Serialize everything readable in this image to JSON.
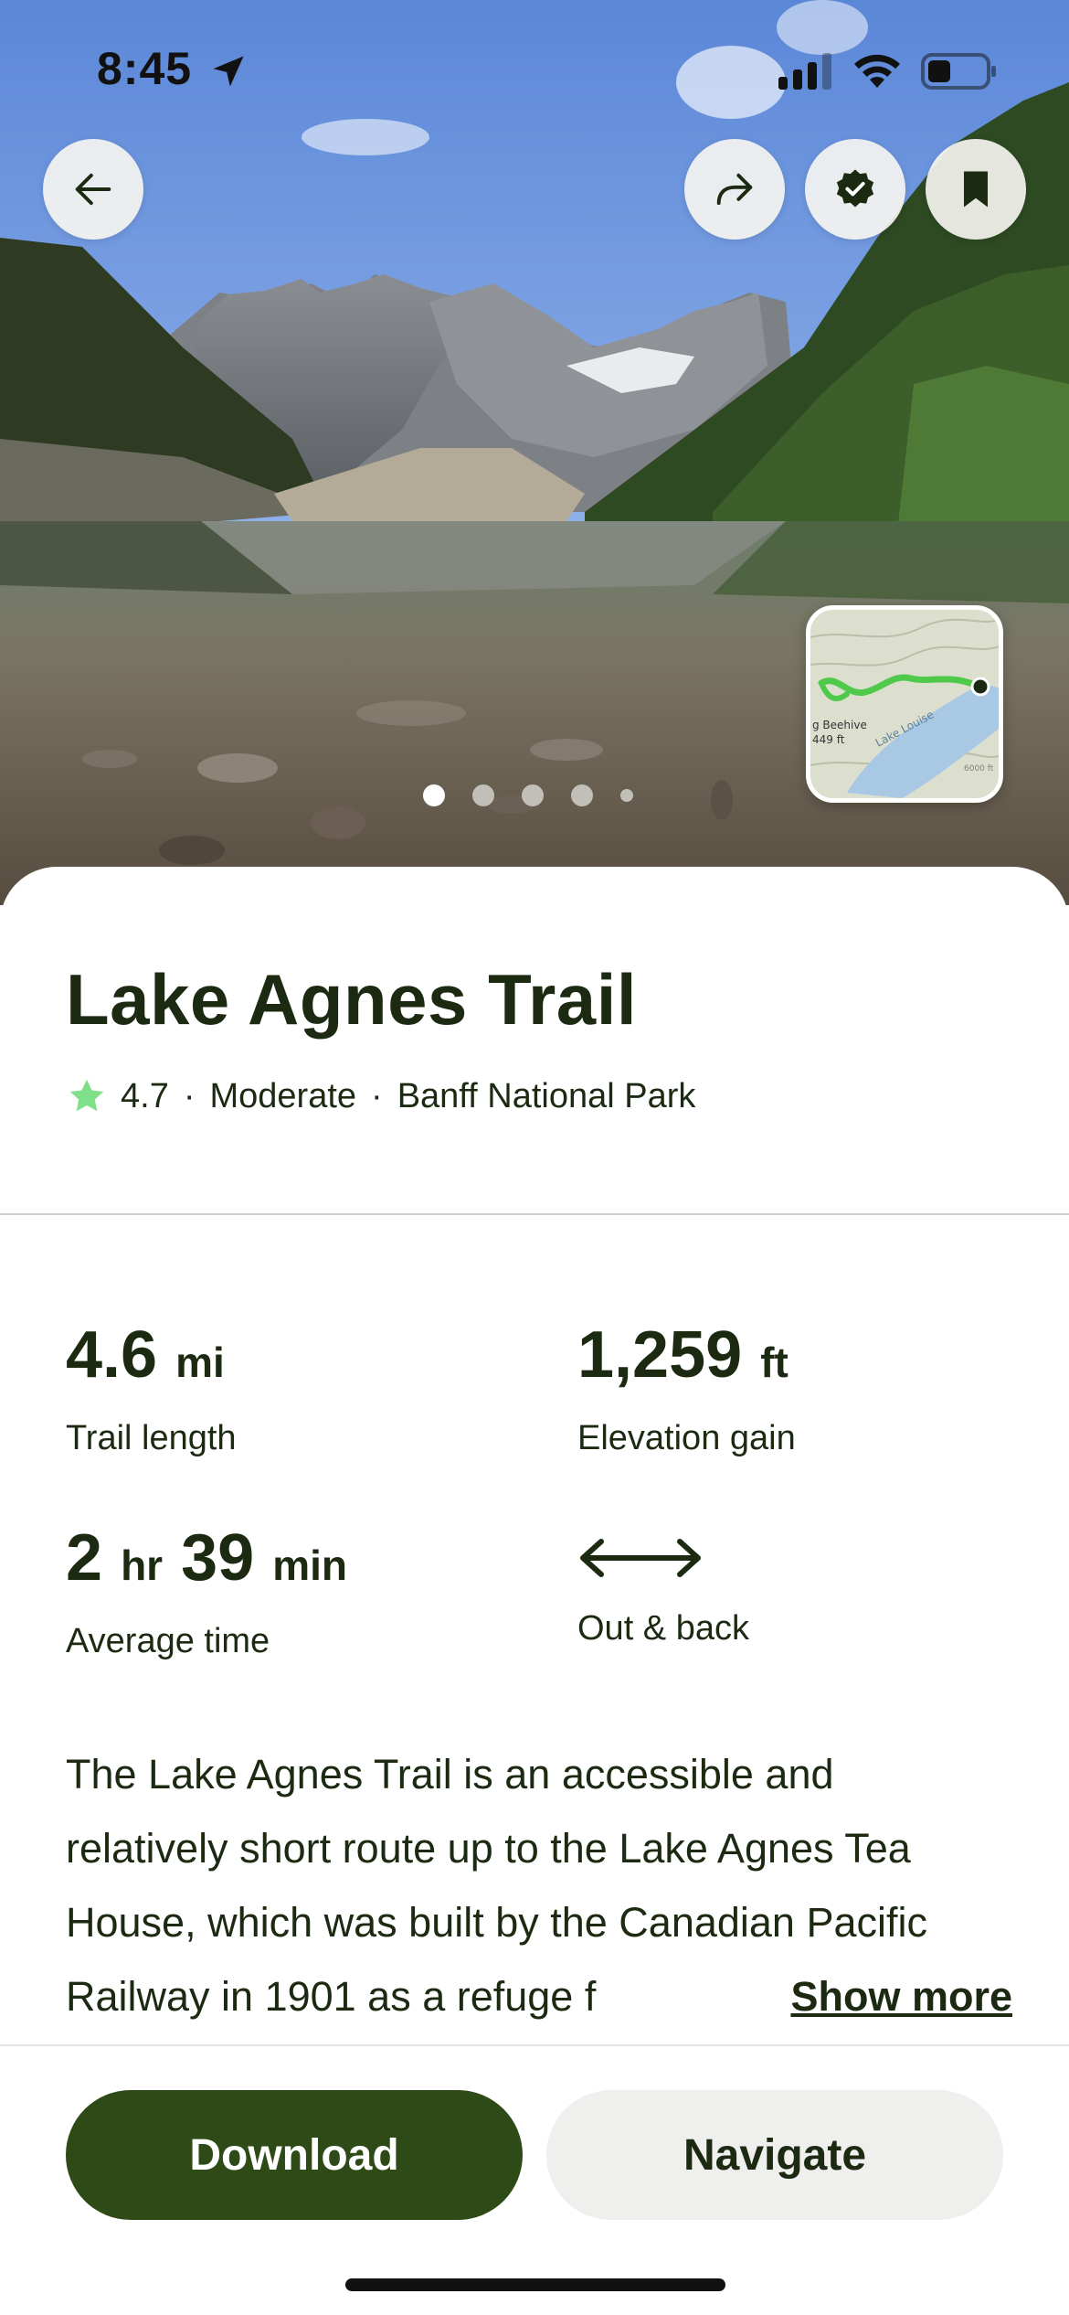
{
  "status_bar": {
    "time": "8:45",
    "location_icon": "location-arrow-icon",
    "signal_icon": "cellular-signal-icon",
    "wifi_icon": "wifi-icon",
    "battery_icon": "battery-icon"
  },
  "header": {
    "back_icon": "arrow-left-icon",
    "share_icon": "share-arrow-icon",
    "verified_icon": "verified-badge-icon",
    "bookmark_icon": "bookmark-icon"
  },
  "carousel": {
    "total_pages": 5,
    "current_page": 1
  },
  "map_preview": {
    "labels": [
      "Lake Louise",
      "g Beehive",
      "449 ft",
      "6000 ft"
    ]
  },
  "trail": {
    "title": "Lake Agnes Trail",
    "rating": "4.7",
    "difficulty": "Moderate",
    "park": "Banff National Park",
    "separator": "·",
    "rating_icon": "star-icon"
  },
  "stats": {
    "length": {
      "value": "4.6",
      "unit": "mi",
      "label": "Trail length"
    },
    "elevation": {
      "value": "1,259",
      "unit": "ft",
      "label": "Elevation gain"
    },
    "time": {
      "hours": "2",
      "hours_unit": "hr",
      "minutes": "39",
      "minutes_unit": "min",
      "label": "Average time"
    },
    "route": {
      "icon": "out-and-back-arrow-icon",
      "label": "Out & back"
    }
  },
  "description": {
    "text": "The Lake Agnes Trail is an accessible and relatively short route up to the Lake Agnes Tea House, which was built by the Canadian Pacific Railway in 1901 as a refuge f",
    "show_more": "Show more"
  },
  "actions": {
    "download": "Download",
    "navigate": "Navigate"
  },
  "colors": {
    "primary_green": "#2e4a16",
    "text_dark": "#1c2a12",
    "star_green": "#7fe08a",
    "secondary_button": "#efefed"
  }
}
